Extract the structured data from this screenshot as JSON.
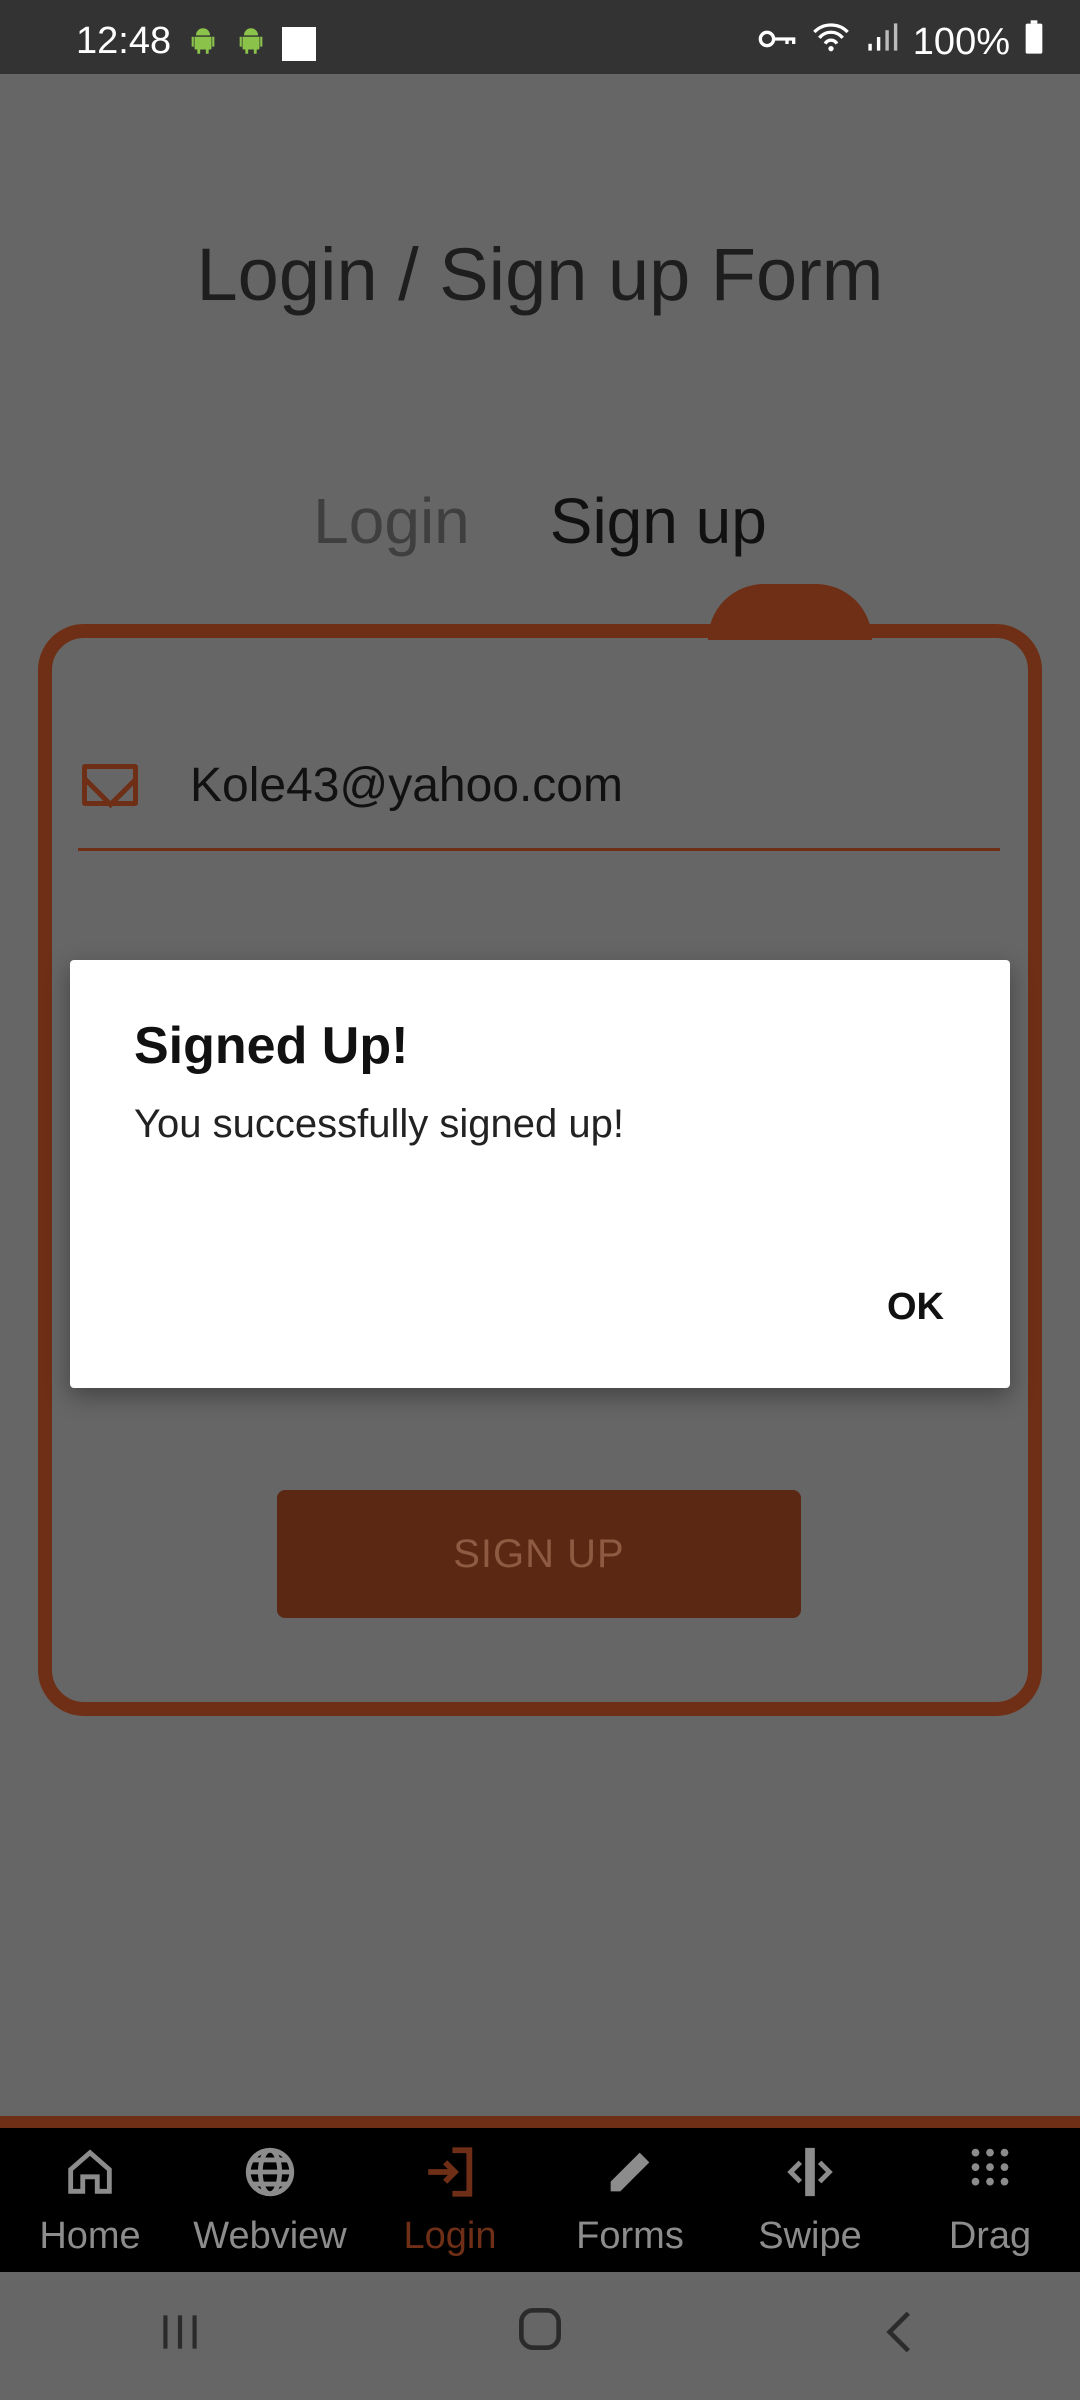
{
  "status_bar": {
    "time": "12:48",
    "battery": "100%",
    "icons": [
      "android-icon",
      "android-icon",
      "square-icon",
      "key-icon",
      "wifi-icon",
      "signal-icon",
      "battery-icon"
    ]
  },
  "page": {
    "title": "Login / Sign up Form",
    "tabs": {
      "login": "Login",
      "signup": "Sign up",
      "active": "signup"
    }
  },
  "form": {
    "email_value": "Kole43@yahoo.com",
    "email_icon": "mail-icon",
    "submit_label": "SIGN UP"
  },
  "dialog": {
    "title": "Signed Up!",
    "message": "You successfully signed up!",
    "ok_label": "OK"
  },
  "bottom_nav": {
    "items": [
      {
        "label": "Home",
        "icon": "home-icon"
      },
      {
        "label": "Webview",
        "icon": "globe-icon"
      },
      {
        "label": "Login",
        "icon": "login-icon",
        "active": true
      },
      {
        "label": "Forms",
        "icon": "pencil-icon"
      },
      {
        "label": "Swipe",
        "icon": "swipe-icon"
      },
      {
        "label": "Drag",
        "icon": "grid-icon"
      }
    ]
  },
  "system_nav": {
    "icons": [
      "recents-icon",
      "home-icon",
      "back-icon"
    ]
  },
  "colors": {
    "accent": "#6f2f16",
    "overlay": "#666666"
  }
}
